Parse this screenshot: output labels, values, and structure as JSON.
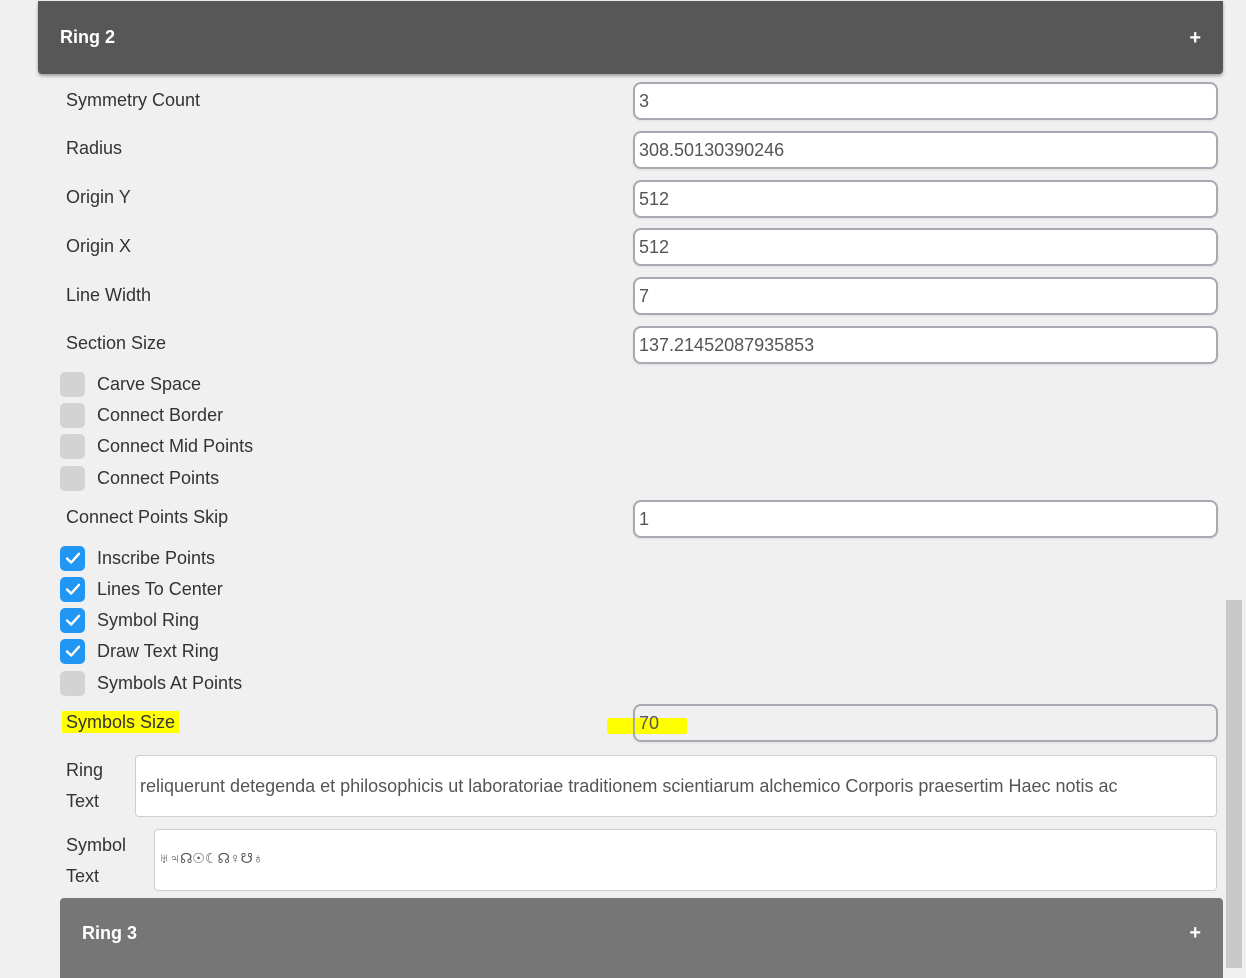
{
  "ring2": {
    "title": "Ring 2",
    "toggle": "+"
  },
  "fields": {
    "symmetry_count": {
      "label": "Symmetry Count",
      "value": "3"
    },
    "radius": {
      "label": "Radius",
      "value": "308.50130390246"
    },
    "origin_y": {
      "label": "Origin Y",
      "value": "512"
    },
    "origin_x": {
      "label": "Origin X",
      "value": "512"
    },
    "line_width": {
      "label": "Line Width",
      "value": "7"
    },
    "section_size": {
      "label": "Section Size",
      "value": "137.21452087935853"
    },
    "connect_points_skip": {
      "label": "Connect Points Skip",
      "value": "1"
    },
    "symbols_size": {
      "label": "Symbols Size",
      "value": "70",
      "highlight_color": "#ffff00"
    }
  },
  "checkboxes_a": [
    {
      "label": "Carve Space",
      "checked": false
    },
    {
      "label": "Connect Border",
      "checked": false
    },
    {
      "label": "Connect Mid Points",
      "checked": false
    },
    {
      "label": "Connect Points",
      "checked": false
    }
  ],
  "checkboxes_b": [
    {
      "label": "Inscribe Points",
      "checked": true
    },
    {
      "label": "Lines To Center",
      "checked": true
    },
    {
      "label": "Symbol Ring",
      "checked": true
    },
    {
      "label": "Draw Text Ring",
      "checked": true
    },
    {
      "label": "Symbols At Points",
      "checked": false
    }
  ],
  "ring_text": {
    "label_line1": "Ring",
    "label_line2": "Text",
    "value": "reliquerunt detegenda et philosophicis ut laboratoriae traditionem scientiarum alchemico Corporis praesertim Haec notis ac"
  },
  "symbol_text": {
    "label_line1": "Symbol",
    "label_line2": "Text",
    "value": "♅♃☊☉☾☊♀☋♁"
  },
  "ring3": {
    "title": "Ring 3",
    "toggle": "+"
  },
  "colors": {
    "checkbox_checked": "#2196f3",
    "checkbox_unchecked": "#d3d3d3",
    "header_dark": "#575757",
    "header_mid": "#767676"
  }
}
